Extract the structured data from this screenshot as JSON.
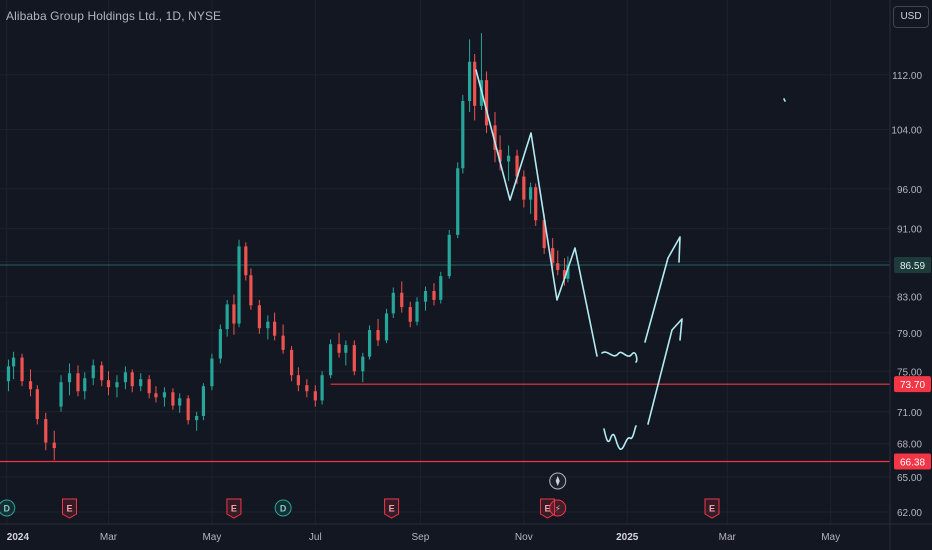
{
  "header": {
    "title": "Alibaba Group Holdings Ltd., 1D, NYSE",
    "currency": "USD"
  },
  "colors": {
    "background": "#131722",
    "up": "#26a69a",
    "down": "#ef5350",
    "grid": "#1e222d",
    "axis_text": "#b2b5be",
    "level_line": "#f23645",
    "last_price_line": "#26a69a",
    "drawing": "#b2ebf2"
  },
  "chart_data": {
    "type": "candlestick",
    "title": "Alibaba Group Holdings Ltd., 1D, NYSE",
    "currency": "USD",
    "y_scale": "log",
    "y_ticks": [
      62,
      65,
      68,
      71,
      75,
      79,
      83,
      87,
      91,
      96,
      104,
      112
    ],
    "y_tick_labels": [
      "62.00",
      "65.00",
      "68.00",
      "71.00",
      "75.00",
      "79.00",
      "83.00",
      "",
      "91.00",
      "96.00",
      "104.00",
      "112.00"
    ],
    "ylim": [
      61,
      119
    ],
    "x_tick_labels": [
      "2024",
      "Mar",
      "May",
      "Jul",
      "Sep",
      "Nov",
      "2025",
      "Mar",
      "May"
    ],
    "x_tick_dates": [
      "2024-01-01",
      "2024-03-01",
      "2024-05-01",
      "2024-07-01",
      "2024-09-01",
      "2024-11-01",
      "2025-01-01",
      "2025-03-01",
      "2025-05-01"
    ],
    "xlim": [
      "2023-12-28",
      "2025-06-05"
    ],
    "last_price": {
      "value": 86.59,
      "label": "86.59"
    },
    "horizontal_levels": [
      {
        "value": 73.7,
        "label": "73.70",
        "start": "2024-07-10"
      },
      {
        "value": 66.38,
        "label": "66.38",
        "start": "2023-12-28"
      }
    ],
    "events": [
      {
        "date": "2024-01-01",
        "label": "D",
        "kind": "dividend"
      },
      {
        "date": "2024-02-07",
        "label": "E",
        "kind": "earnings"
      },
      {
        "date": "2024-05-14",
        "label": "E",
        "kind": "earnings"
      },
      {
        "date": "2024-06-12",
        "label": "D",
        "kind": "dividend"
      },
      {
        "date": "2024-08-15",
        "label": "E",
        "kind": "earnings"
      },
      {
        "date": "2024-11-15",
        "label": "E",
        "kind": "earnings"
      },
      {
        "date": "2024-11-21",
        "label": "⚡",
        "kind": "alert"
      },
      {
        "date": "2025-02-20",
        "label": "E",
        "kind": "earnings"
      }
    ],
    "candles": [
      [
        "2024-01-02",
        74.0,
        76.2,
        73.0,
        75.5
      ],
      [
        "2024-01-05",
        75.5,
        77.0,
        74.2,
        76.4
      ],
      [
        "2024-01-10",
        76.4,
        76.8,
        73.5,
        74.0
      ],
      [
        "2024-01-15",
        74.0,
        75.2,
        72.5,
        73.2
      ],
      [
        "2024-01-19",
        73.2,
        73.6,
        69.8,
        70.3
      ],
      [
        "2024-01-24",
        70.3,
        70.9,
        67.4,
        68.1
      ],
      [
        "2024-01-29",
        68.1,
        69.2,
        66.5,
        67.6
      ],
      [
        "2024-02-02",
        71.5,
        74.6,
        71.0,
        73.9
      ],
      [
        "2024-02-07",
        73.9,
        75.8,
        72.6,
        74.8
      ],
      [
        "2024-02-12",
        74.8,
        75.6,
        72.5,
        73.0
      ],
      [
        "2024-02-16",
        73.0,
        74.9,
        72.2,
        74.3
      ],
      [
        "2024-02-21",
        74.3,
        76.2,
        73.6,
        75.6
      ],
      [
        "2024-02-26",
        75.6,
        76.0,
        73.5,
        74.1
      ],
      [
        "2024-03-01",
        74.1,
        75.0,
        72.6,
        73.4
      ],
      [
        "2024-03-06",
        73.4,
        74.6,
        72.4,
        73.9
      ],
      [
        "2024-03-11",
        73.9,
        75.5,
        73.2,
        74.9
      ],
      [
        "2024-03-15",
        74.9,
        75.2,
        72.9,
        73.5
      ],
      [
        "2024-03-20",
        73.5,
        74.8,
        73.0,
        74.2
      ],
      [
        "2024-03-25",
        74.2,
        74.6,
        72.3,
        72.8
      ],
      [
        "2024-03-29",
        72.8,
        73.5,
        71.9,
        72.4
      ],
      [
        "2024-04-03",
        72.4,
        73.4,
        71.5,
        72.9
      ],
      [
        "2024-04-08",
        72.9,
        73.3,
        71.2,
        71.6
      ],
      [
        "2024-04-12",
        71.6,
        72.8,
        70.9,
        72.3
      ],
      [
        "2024-04-17",
        72.3,
        72.6,
        69.8,
        70.2
      ],
      [
        "2024-04-22",
        70.2,
        71.0,
        69.2,
        70.6
      ],
      [
        "2024-04-26",
        70.6,
        73.8,
        70.2,
        73.5
      ],
      [
        "2024-05-01",
        73.5,
        76.8,
        73.1,
        76.3
      ],
      [
        "2024-05-06",
        76.3,
        79.9,
        75.8,
        79.4
      ],
      [
        "2024-05-10",
        79.4,
        82.6,
        78.6,
        82.1
      ],
      [
        "2024-05-14",
        82.1,
        83.2,
        78.8,
        80.0
      ],
      [
        "2024-05-17",
        80.0,
        89.6,
        79.6,
        88.8
      ],
      [
        "2024-05-21",
        88.8,
        89.3,
        84.8,
        85.4
      ],
      [
        "2024-05-24",
        85.4,
        86.2,
        81.5,
        82.0
      ],
      [
        "2024-05-29",
        82.0,
        82.6,
        78.9,
        79.5
      ],
      [
        "2024-06-03",
        79.5,
        80.9,
        78.3,
        80.2
      ],
      [
        "2024-06-07",
        80.2,
        81.2,
        78.2,
        78.7
      ],
      [
        "2024-06-12",
        78.7,
        79.9,
        76.8,
        77.2
      ],
      [
        "2024-06-17",
        77.2,
        77.6,
        74.0,
        74.6
      ],
      [
        "2024-06-21",
        74.6,
        75.4,
        73.0,
        73.6
      ],
      [
        "2024-06-26",
        73.6,
        74.2,
        72.4,
        73.0
      ],
      [
        "2024-07-01",
        73.0,
        73.6,
        71.5,
        72.1
      ],
      [
        "2024-07-05",
        72.1,
        75.0,
        71.7,
        74.6
      ],
      [
        "2024-07-10",
        74.6,
        78.3,
        74.3,
        77.8
      ],
      [
        "2024-07-15",
        77.8,
        79.0,
        76.4,
        76.9
      ],
      [
        "2024-07-19",
        76.9,
        78.2,
        75.6,
        77.7
      ],
      [
        "2024-07-24",
        77.7,
        78.2,
        74.6,
        75.0
      ],
      [
        "2024-07-29",
        75.0,
        76.9,
        73.9,
        76.5
      ],
      [
        "2024-08-02",
        76.5,
        79.8,
        76.2,
        79.3
      ],
      [
        "2024-08-07",
        79.3,
        80.5,
        77.6,
        78.2
      ],
      [
        "2024-08-12",
        78.2,
        81.6,
        77.9,
        81.1
      ],
      [
        "2024-08-16",
        81.1,
        84.0,
        80.6,
        83.4
      ],
      [
        "2024-08-21",
        83.4,
        84.7,
        81.2,
        81.8
      ],
      [
        "2024-08-26",
        81.8,
        82.4,
        79.6,
        80.2
      ],
      [
        "2024-08-30",
        80.2,
        82.9,
        79.8,
        82.4
      ],
      [
        "2024-09-04",
        82.4,
        84.1,
        81.4,
        83.6
      ],
      [
        "2024-09-09",
        83.6,
        84.5,
        82.0,
        82.6
      ],
      [
        "2024-09-13",
        82.6,
        85.8,
        82.2,
        85.3
      ],
      [
        "2024-09-18",
        85.3,
        90.8,
        85.0,
        90.2
      ],
      [
        "2024-09-23",
        90.2,
        99.5,
        89.8,
        98.7
      ],
      [
        "2024-09-26",
        98.7,
        109.0,
        98.0,
        108.1
      ],
      [
        "2024-09-30",
        108.1,
        117.5,
        106.5,
        114.0
      ],
      [
        "2024-10-03",
        114.0,
        115.2,
        105.3,
        107.4
      ],
      [
        "2024-10-07",
        107.4,
        118.5,
        106.8,
        111.2
      ],
      [
        "2024-10-10",
        111.2,
        112.5,
        103.5,
        104.6
      ],
      [
        "2024-10-15",
        104.6,
        106.5,
        99.5,
        101.2
      ],
      [
        "2024-10-18",
        101.2,
        103.2,
        98.4,
        99.6
      ],
      [
        "2024-10-23",
        99.6,
        101.8,
        97.0,
        100.4
      ],
      [
        "2024-10-28",
        100.4,
        101.2,
        96.6,
        97.6
      ],
      [
        "2024-11-01",
        97.6,
        98.4,
        93.6,
        94.6
      ],
      [
        "2024-11-05",
        94.6,
        96.8,
        92.8,
        96.2
      ],
      [
        "2024-11-08",
        96.2,
        96.7,
        91.3,
        92.0
      ],
      [
        "2024-11-13",
        92.0,
        92.8,
        87.9,
        88.6
      ],
      [
        "2024-11-18",
        88.6,
        89.8,
        86.0,
        86.8
      ],
      [
        "2024-11-21",
        86.8,
        88.3,
        85.4,
        86.0
      ],
      [
        "2024-11-25",
        86.0,
        87.4,
        84.2,
        85.0
      ],
      [
        "2024-11-27",
        85.0,
        87.6,
        84.6,
        86.59
      ]
    ]
  }
}
